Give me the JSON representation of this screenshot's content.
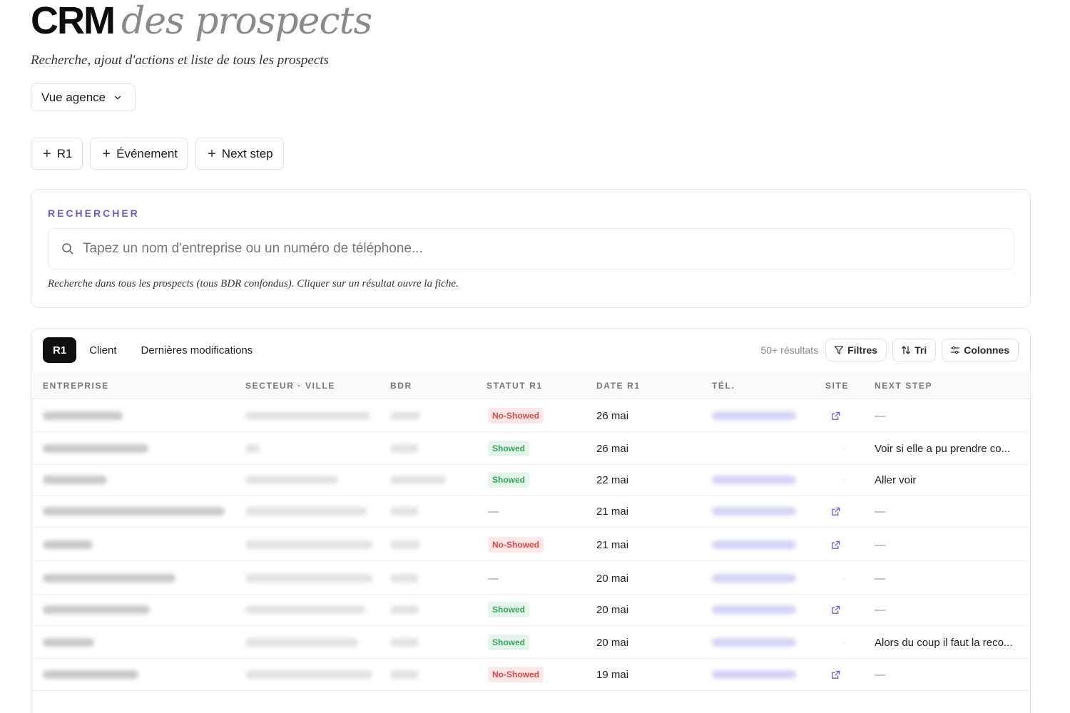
{
  "header": {
    "title_bold": "CRM",
    "title_italic": "des prospects",
    "subtitle": "Recherche, ajout d'actions et liste de tous les prospects"
  },
  "view_select": {
    "value": "Vue agence"
  },
  "actions": [
    {
      "label": "R1"
    },
    {
      "label": "Événement"
    },
    {
      "label": "Next step"
    }
  ],
  "search": {
    "label": "RECHERCHER",
    "placeholder": "Tapez un nom d'entreprise ou un numéro de téléphone...",
    "hint": "Recherche dans tous les prospects (tous BDR confondus). Cliquer sur un résultat ouvre la fiche."
  },
  "tabs": [
    {
      "label": "R1",
      "active": true
    },
    {
      "label": "Client",
      "active": false
    },
    {
      "label": "Dernières modifications",
      "active": false
    }
  ],
  "toolbar": {
    "results": "50+ résultats",
    "filters": "Filtres",
    "sort": "Tri",
    "columns": "Colonnes"
  },
  "table": {
    "headers": [
      "ENTREPRISE",
      "SECTEUR · VILLE",
      "BDR",
      "STATUT R1",
      "DATE R1",
      "TÉL.",
      "SITE",
      "NEXT STEP"
    ],
    "rows": [
      {
        "statut": "No-Showed",
        "date": "26 mai",
        "site": "link",
        "next": "—"
      },
      {
        "statut": "Showed",
        "date": "26 mai",
        "site": "none",
        "next": "Voir si elle a pu prendre co..."
      },
      {
        "statut": "Showed",
        "date": "22 mai",
        "site": "none",
        "next": "Aller voir"
      },
      {
        "statut": "—",
        "date": "21 mai",
        "site": "link",
        "next": "—"
      },
      {
        "statut": "No-Showed",
        "date": "21 mai",
        "site": "link",
        "next": "—"
      },
      {
        "statut": "—",
        "date": "20 mai",
        "site": "none",
        "next": "—"
      },
      {
        "statut": "Showed",
        "date": "20 mai",
        "site": "link",
        "next": "—"
      },
      {
        "statut": "Showed",
        "date": "20 mai",
        "site": "none",
        "next": "Alors du coup il faut la reco..."
      },
      {
        "statut": "No-Showed",
        "date": "19 mai",
        "site": "link",
        "next": "—"
      }
    ]
  },
  "colors": {
    "accent": "#6b5bd6",
    "no_showed": "#d94a4a",
    "showed": "#35a55e",
    "tab_active_bg": "#0f0f0f"
  },
  "icons": {
    "chevron": "chevron-down-icon",
    "plus": "plus-icon",
    "search": "search-icon",
    "filter": "filter-icon",
    "sort": "sort-icon",
    "columns": "columns-icon",
    "external": "external-link-icon"
  }
}
